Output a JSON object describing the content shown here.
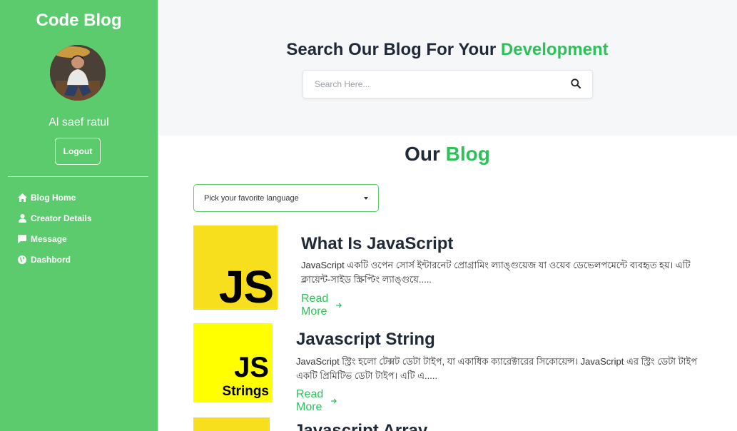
{
  "sidebar": {
    "brand": "Code Blog",
    "username": "Al saef ratul",
    "logout_label": "Logout",
    "nav": [
      {
        "label": "Blog Home",
        "icon": "home-icon"
      },
      {
        "label": "Creator Details",
        "icon": "user-icon"
      },
      {
        "label": "Message",
        "icon": "message-icon"
      },
      {
        "label": "Dashbord",
        "icon": "globe-icon"
      }
    ],
    "bg_color": "#5ccb6d"
  },
  "hero": {
    "title_prefix": "Search Our Blog For Your",
    "title_accent": "Development",
    "search_placeholder": "Search Here...",
    "search_icon": "search-icon"
  },
  "blog": {
    "title_prefix": "Our",
    "title_accent": "Blog",
    "language_select": "Pick your favorite language",
    "posts": [
      {
        "thumb_text": "JS",
        "title": "What Is JavaScript",
        "excerpt": "JavaScript একটি ওপেন সোর্স ইন্টারনেট প্রোগ্রামিং ল্যাঙ্গুয়েজ যা ওয়েব ডেভেলপমেন্টে ব্যবহৃত হয়। এটি ক্লায়েন্ট-সাইড স্ক্রিপ্টিং ল্যাঙ্গুয়ে.....",
        "read_more": "Read More"
      },
      {
        "thumb_text": "JS",
        "thumb_subtext": "Strings",
        "title": "Javascript String",
        "excerpt": "JavaScript স্ট্রিং হলো টেক্সট ডেটা টাইপ, যা একাধিক ক্যারেক্টারের সিকোয়েন্স। JavaScript এর স্ট্রিং ডেটা টাইপ একটি প্রিমিটিভ ডেটা টাইপ। এটি এ.....",
        "read_more": "Read More"
      },
      {
        "title": "Javascript Array"
      }
    ]
  },
  "colors": {
    "accent": "#2ec15a",
    "js_yellow": "#f7df1e",
    "strings_yellow": "#ffff00"
  }
}
